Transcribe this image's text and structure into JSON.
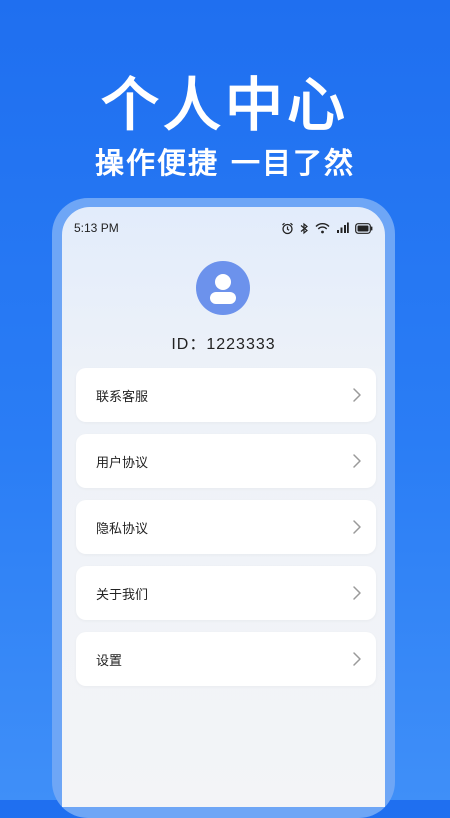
{
  "header": {
    "title": "个人中心",
    "subtitle": "操作便捷 一目了然"
  },
  "status_bar": {
    "time": "5:13 PM"
  },
  "profile": {
    "id_text": "ID：1223333"
  },
  "menu": {
    "items": [
      {
        "label": "联系客服"
      },
      {
        "label": "用户协议"
      },
      {
        "label": "隐私协议"
      },
      {
        "label": "关于我们"
      },
      {
        "label": "设置"
      }
    ]
  },
  "colors": {
    "background": "#2a7df5",
    "avatar": "#6c92ec",
    "card": "#ffffff"
  },
  "icons": [
    "alarm-icon",
    "bluetooth-icon",
    "wifi-icon",
    "signal-icon",
    "battery-icon",
    "avatar-icon",
    "chevron-right-icon"
  ]
}
